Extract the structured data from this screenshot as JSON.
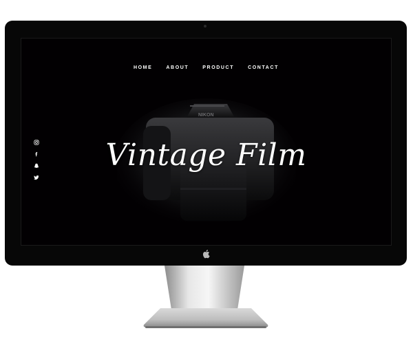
{
  "nav": {
    "items": [
      {
        "label": "HOME"
      },
      {
        "label": "ABOUT"
      },
      {
        "label": "PRODUCT"
      },
      {
        "label": "CONTACT"
      }
    ]
  },
  "hero": {
    "title": "Vintage Film",
    "image_icon": "camera-photo"
  },
  "social": {
    "icons": [
      "instagram-icon",
      "facebook-icon",
      "snapchat-icon",
      "twitter-icon"
    ]
  },
  "device": {
    "logo_icon": "apple-logo-icon"
  },
  "colors": {
    "screen_background": "#020002",
    "bezel": "#070707",
    "text": "#ffffff"
  }
}
